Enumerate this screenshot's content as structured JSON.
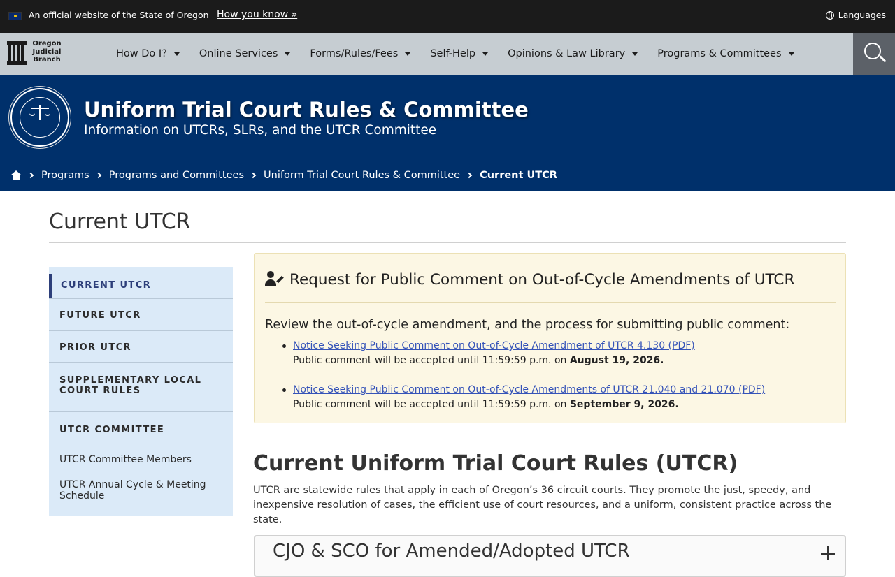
{
  "topbar": {
    "official_text": "An official website of the State of Oregon",
    "how_you_know": "How you know »",
    "languages": "Languages"
  },
  "brand": {
    "line1": "Oregon",
    "line2": "Judicial",
    "line3": "Branch"
  },
  "nav": {
    "items": [
      {
        "label": "How Do I?"
      },
      {
        "label": "Online Services"
      },
      {
        "label": "Forms/Rules/Fees"
      },
      {
        "label": "Self-Help"
      },
      {
        "label": "Opinions & Law Library"
      },
      {
        "label": "Programs & Committees"
      }
    ]
  },
  "banner": {
    "title": "Uniform Trial Court Rules & Committee",
    "subtitle": "Information on UTCRs, SLRs, and the UTCR Committee"
  },
  "breadcrumb": {
    "items": [
      "Programs",
      "Programs and Committees",
      "Uniform Trial Court Rules & Committee",
      "Current UTCR"
    ]
  },
  "page": {
    "title": "Current UTCR"
  },
  "sidenav": {
    "items": [
      "CURRENT UTCR",
      "FUTURE UTCR",
      "PRIOR UTCR",
      "SUPPLEMENTARY LOCAL COURT RULES",
      "UTCR COMMITTEE"
    ],
    "sub_items": [
      "UTCR Committee Members",
      "UTCR Annual Cycle & Meeting Schedule"
    ]
  },
  "alert": {
    "title": "Request for Public Comment on Out-of-Cycle Amendments of UTCR",
    "intro": "Review the out-of-cycle amendment, and the process for submitting public comment:",
    "items": [
      {
        "link": "Notice Seeking Public Comment on Out-of-Cycle Amendment of UTCR 4.130 (PDF)",
        "note": "Public comment will be accepted until 11:59:59 p.m. on ",
        "date": "August 19, 2026."
      },
      {
        "link": "Notice Seeking Public Comment on Out-of-Cycle Amendments of UTCR 21.040 and 21.070 (PDF)",
        "note": "Public comment will be accepted until 11:59:59 p.m. on ",
        "date": "September 9, 2026."
      }
    ]
  },
  "main": {
    "heading": "Current Uniform Trial Court Rules (UTCR)",
    "intro": "UTCR are statewide rules that apply in each of Oregon’s 36 circuit courts. They promote the just, speedy, and inexpensive resolution of cases, the efficient use of court resources, and a uniform, consistent practice across the state.",
    "accordion_title": "CJO & SCO for Amended/Adopted UTCR"
  }
}
